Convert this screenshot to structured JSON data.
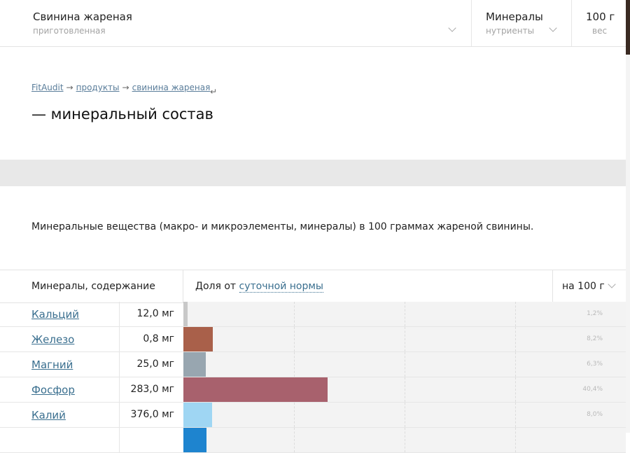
{
  "topbar": {
    "product": {
      "title": "Свинина жареная",
      "subtitle": "приготовленная"
    },
    "nutrients": {
      "title": "Минералы",
      "subtitle": "нутриенты"
    },
    "weight": {
      "title": "100 г",
      "subtitle": "вес"
    }
  },
  "breadcrumb": {
    "site": "FitAudit",
    "products": "продукты",
    "current": "свинина жареная",
    "separator": "→",
    "hook": "↵"
  },
  "page_title": "— минеральный состав",
  "description": "Минеральные вещества (макро- и микроэлементы, минералы) в 100 граммах жареной свинины.",
  "table": {
    "header": {
      "name": "Минералы, содержание",
      "share_prefix": "Доля от ",
      "share_link": "суточной нормы",
      "per": "на 100 г"
    },
    "rows": [
      {
        "name": "Кальций",
        "value": "12,0 мг",
        "percent_label": "1,2%",
        "percent": 1.2,
        "color": "#c8c8c8"
      },
      {
        "name": "Железо",
        "value": "0,8 мг",
        "percent_label": "8,2%",
        "percent": 8.2,
        "color": "#a9604a"
      },
      {
        "name": "Магний",
        "value": "25,0 мг",
        "percent_label": "6,3%",
        "percent": 6.3,
        "color": "#98a6b0"
      },
      {
        "name": "Фосфор",
        "value": "283,0 мг",
        "percent_label": "40,4%",
        "percent": 40.4,
        "color": "#a8616d"
      },
      {
        "name": "Калий",
        "value": "376,0 мг",
        "percent_label": "8,0%",
        "percent": 8.0,
        "color": "#9fd6f3"
      },
      {
        "name": "",
        "value": "",
        "percent_label": "",
        "percent": 6.5,
        "color": "#1e84cf"
      }
    ]
  },
  "scale_max_percent": 100
}
